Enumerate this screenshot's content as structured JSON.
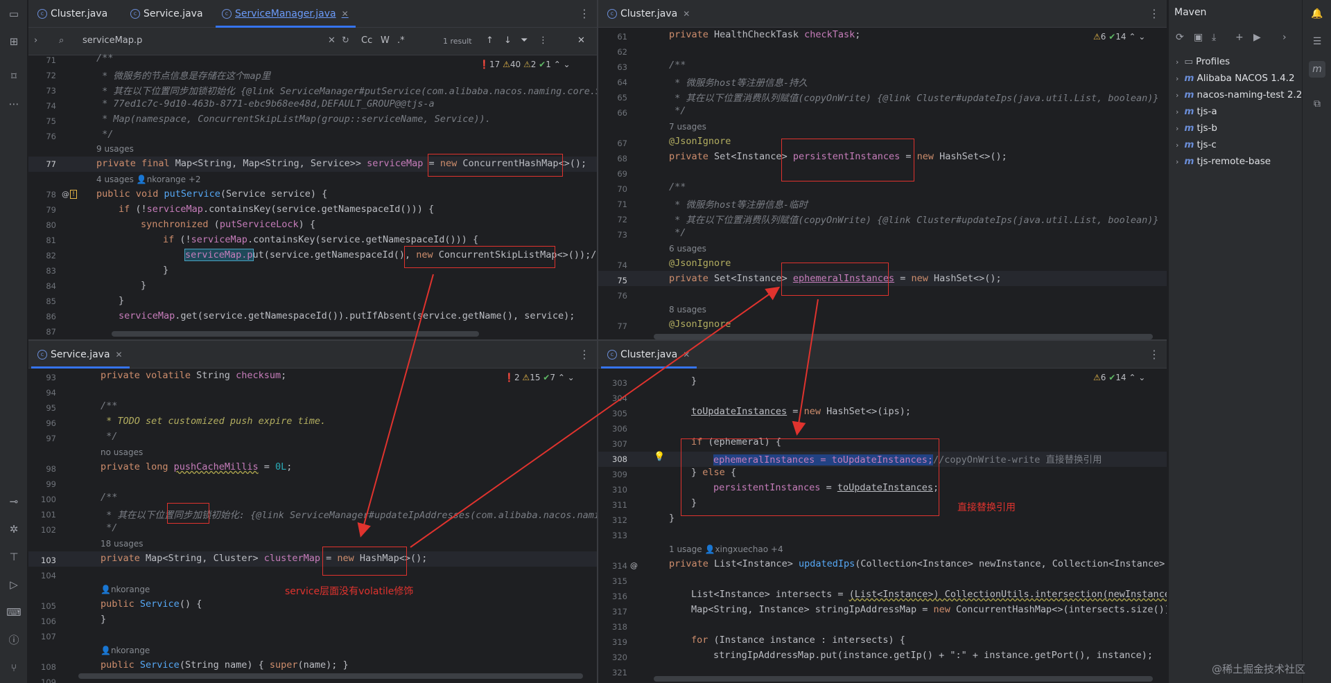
{
  "tabs_top_left": [
    "Cluster.java",
    "Service.java",
    "ServiceManager.java"
  ],
  "tabs_top_right": [
    "Cluster.java"
  ],
  "tabs_bottom_left": [
    "Service.java"
  ],
  "tabs_bottom_right": [
    "Cluster.java"
  ],
  "find": {
    "query": "serviceMap.p",
    "case_label": "Cc",
    "word_label": "W",
    "regex_label": ".*",
    "result": "1 result"
  },
  "inspect_tl": {
    "err": "17",
    "warn": "40",
    "weak": "2",
    "ok": "1"
  },
  "inspect_tr": {
    "warn": "6",
    "ok": "14"
  },
  "inspect_bl": {
    "err": "2",
    "warn": "15",
    "ok": "7"
  },
  "inspect_br": {
    "warn": "6",
    "ok": "14"
  },
  "maven": {
    "title": "Maven",
    "items": [
      "Profiles",
      "Alibaba NACOS 1.4.2",
      "nacos-naming-test 2.2",
      "tjs-a",
      "tjs-b",
      "tjs-c",
      "tjs-remote-base"
    ]
  },
  "annotations": {
    "service_note": "service层面没有volatile修饰",
    "cluster_note": "直接替换引用"
  },
  "watermark": "@稀土掘金技术社区",
  "tl": {
    "lines": [
      "71",
      "72",
      "73",
      "74",
      "75",
      "76",
      "77",
      "78",
      "79",
      "80",
      "81",
      "82",
      "83",
      "84",
      "85",
      "86",
      "87"
    ],
    "c71": "/**",
    "c72": " * 微服务的节点信息是存储在这个map里",
    "c73": " * 其在以下位置同步加锁初始化 {@link ServiceManager#putService(com.alibaba.nacos.naming.core.Se",
    "c74": " * 77ed1c7c-9d10-463b-8771-ebc9b68ee48d,DEFAULT_GROUP@@tjs-a",
    "c75": " * Map(namespace, ConcurrentSkipListMap(group::serviceName, Service)).",
    "c76": " */",
    "h1": "9 usages",
    "c77a": "private final ",
    "c77b": "Map<String, Map<String, Service>> ",
    "c77c": "serviceMap",
    " c77d": "",
    "c77e": " = ",
    "c77f": "new ",
    "c77g": "ConcurrentHashMap<>();",
    "h2": "4 usages",
    "h2b": "nkorange +2",
    "c78a": "public void ",
    "c78b": "putService",
    "c78c": "(Service service) {",
    "c79a": "if ",
    "c79b": "(!",
    "c79c": "serviceMap",
    ".c79d": "",
    "c79e": ".containsKey(service.getNamespaceId())) {",
    "c80a": "synchronized ",
    "c80b": "(",
    "c80c": "putServiceLock",
    "c80d": ") {",
    "c81a": "if ",
    "c81b": "(!",
    "c81c": "serviceMap",
    "c81d": ".containsKey(service.getNamespaceId())) {",
    "c82a": "serviceMap.p",
    "c82b": "ut(service.getNamespaceId(), ",
    "c82c": "new ",
    "c82d": "ConcurrentSkipListMap<>());//",
    "c83": "}",
    "c84": "}",
    "c85": "}",
    "c86a": "serviceMap",
    "c86b": ".get(service.getNamespaceId()).putIfAbsent(service.getName(), service);"
  },
  "tr": {
    "lines": [
      "61",
      "62",
      "63",
      "64",
      "65",
      "66",
      "67",
      "68",
      "69",
      "70",
      "71",
      "72",
      "73",
      "74",
      "75",
      "76",
      "77"
    ],
    "c61a": "private ",
    "c61b": "HealthCheckTask ",
    "c61c": "checkTask",
    ";": "",
    "c63": "/**",
    "c64": " * 微服务host等注册信息-持久",
    "c65": " * 其在以下位置消费队列赋值(copyOnWrite) {@link Cluster#updateIps(java.util.List, boolean)}",
    "c66": " */",
    "h1": "7 usages",
    "c67": "@JsonIgnore",
    "c68a": "private ",
    "c68b": "Set<Instance> ",
    "c68c": "persistentInstances",
    "c68d": " = ",
    "c68e": "new ",
    "c68f": "HashSet<>();",
    "c70": "/**",
    "c71": " * 微服务host等注册信息-临时",
    "c72": " * 其在以下位置消费队列赋值(copyOnWrite) {@link Cluster#updateIps(java.util.List, boolean)}",
    "c73": " */",
    "h2": "6 usages",
    "c74": "@JsonIgnore",
    "c75a": "private ",
    "c75b": "Set<Instance> ",
    "c75c": "ephemeralInstances",
    "c75d": " = ",
    "c75e": "new ",
    "c75f": "HashSet<>();",
    "h3": "8 usages",
    "c77": "@JsonIgnore"
  },
  "bl": {
    "lines": [
      "93",
      "94",
      "95",
      "96",
      "97",
      "98",
      "99",
      "100",
      "101",
      "102",
      "103",
      "104",
      "105",
      "106",
      "107",
      "108",
      "109"
    ],
    "c93a": "private volatile ",
    "c93b": "String ",
    "c93c": "checksum",
    ";": "",
    "c95": "/**",
    "c96": " * TODO set customized push expire time.",
    "c97": " */",
    "h1": "no usages",
    "c98a": "private long ",
    "c98b": "pushCacheMillis",
    " c98c": "",
    "c98d": " = ",
    "c98e": "0L",
    "c100": "/**",
    "c101": " * 其在以下位置同步加锁初始化: {@link ServiceManager#updateIpAddresses(com.alibaba.nacos.naming",
    "c102": " */",
    "h2": "18 usages",
    "c103a": "private ",
    "c103b": "Map<String, Cluster> ",
    "c103c": "clusterMap",
    "c103d": " = ",
    "c103e": "new ",
    "c103f": "HashMap<>();",
    "h3": "nkorange",
    "c105a": "public ",
    "c105b": "Service",
    "c105c": "() {",
    "c106": "}",
    "h4": "nkorange",
    "c108a": "public ",
    "c108b": "Service",
    "c108c": "(String name) { ",
    "c108d": "super",
    "c108e": "(name); }"
  },
  "br": {
    "lines": [
      "303",
      "304",
      "305",
      "306",
      "307",
      "308",
      "309",
      "310",
      "311",
      "312",
      "313",
      "314",
      "315",
      "316",
      "317",
      "318",
      "319",
      "320",
      "321"
    ],
    "c303": "}",
    "c305a": "toUpdateInstances",
    "c305b": " = ",
    "c305c": "new ",
    "c305d": "HashSet<>(ips);",
    "c307a": "if ",
    "c307b": "(ephemeral) {",
    "c308a": "ephemeralInstances = toUpdateInstances;",
    "c308b": "//copyOnWrite-write 直接替换引用",
    "c309a": "} ",
    "c309b": "else ",
    "c309c": "{",
    "c310a": "persistentInstances",
    " c310b": "",
    "c310c": " = ",
    "c310d": "toUpdateInstances",
    ";": "",
    "c311": "}",
    "c312": "}",
    "h1": "1 usage",
    "h1b": "xingxuechao +4",
    "c314a": "private ",
    "c314b": "List<Instance> ",
    "c314c": "updatedIps",
    "c314d": "(Collection<Instance> newInstance, Collection<Instance> o",
    "c316a": "List<Instance> intersects = ",
    "c316b": "(List<Instance>) CollectionUtils.intersection(newInstance,",
    "c317a": "Map<String, Instance> stringIpAddressMap = ",
    "c317b": "new ",
    "c317c": "ConcurrentHashMap<>(intersects.size());",
    "c319a": "for ",
    "c319b": "(Instance instance : intersects) {",
    "c320": "stringIpAddressMap.put(instance.getIp() + \":\" + instance.getPort(), instance);"
  }
}
